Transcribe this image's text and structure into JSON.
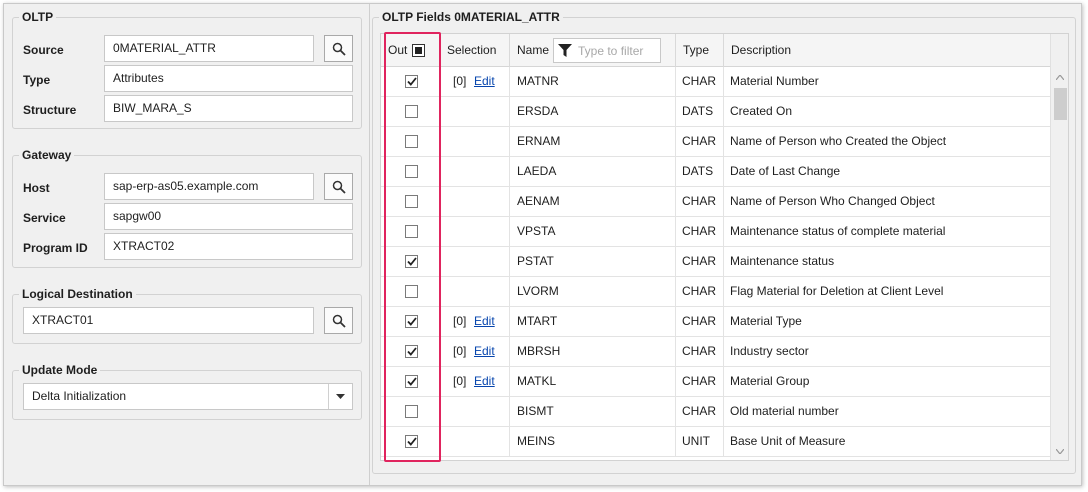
{
  "oltp": {
    "legend": "OLTP",
    "source_label": "Source",
    "source_value": "0MATERIAL_ATTR",
    "type_label": "Type",
    "type_value": "Attributes",
    "structure_label": "Structure",
    "structure_value": "BIW_MARA_S"
  },
  "gateway": {
    "legend": "Gateway",
    "host_label": "Host",
    "host_value": "sap-erp-as05.example.com",
    "service_label": "Service",
    "service_value": "sapgw00",
    "program_label": "Program ID",
    "program_value": "XTRACT02"
  },
  "logical_destination": {
    "legend": "Logical Destination",
    "value": "XTRACT01"
  },
  "update_mode": {
    "legend": "Update Mode",
    "selected": "Delta Initialization"
  },
  "fields": {
    "legend": "OLTP Fields 0MATERIAL_ATTR",
    "columns": {
      "out": "Out",
      "selection": "Selection",
      "name": "Name",
      "filter_placeholder": "Type to filter",
      "type": "Type",
      "description": "Description"
    },
    "rows": [
      {
        "checked": true,
        "count": "[0]",
        "edit": "Edit",
        "name": "MATNR",
        "type": "CHAR",
        "description": "Material Number"
      },
      {
        "checked": false,
        "count": "",
        "edit": "",
        "name": "ERSDA",
        "type": "DATS",
        "description": "Created On"
      },
      {
        "checked": false,
        "count": "",
        "edit": "",
        "name": "ERNAM",
        "type": "CHAR",
        "description": "Name of Person who Created the Object"
      },
      {
        "checked": false,
        "count": "",
        "edit": "",
        "name": "LAEDA",
        "type": "DATS",
        "description": "Date of Last Change"
      },
      {
        "checked": false,
        "count": "",
        "edit": "",
        "name": "AENAM",
        "type": "CHAR",
        "description": "Name of Person Who Changed Object"
      },
      {
        "checked": false,
        "count": "",
        "edit": "",
        "name": "VPSTA",
        "type": "CHAR",
        "description": "Maintenance status of complete material"
      },
      {
        "checked": true,
        "count": "",
        "edit": "",
        "name": "PSTAT",
        "type": "CHAR",
        "description": "Maintenance status"
      },
      {
        "checked": false,
        "count": "",
        "edit": "",
        "name": "LVORM",
        "type": "CHAR",
        "description": "Flag Material for Deletion at Client Level"
      },
      {
        "checked": true,
        "count": "[0]",
        "edit": "Edit",
        "name": "MTART",
        "type": "CHAR",
        "description": "Material Type"
      },
      {
        "checked": true,
        "count": "[0]",
        "edit": "Edit",
        "name": "MBRSH",
        "type": "CHAR",
        "description": "Industry sector"
      },
      {
        "checked": true,
        "count": "[0]",
        "edit": "Edit",
        "name": "MATKL",
        "type": "CHAR",
        "description": "Material Group"
      },
      {
        "checked": false,
        "count": "",
        "edit": "",
        "name": "BISMT",
        "type": "CHAR",
        "description": "Old material number"
      },
      {
        "checked": true,
        "count": "",
        "edit": "",
        "name": "MEINS",
        "type": "UNIT",
        "description": "Base Unit of Measure"
      }
    ]
  },
  "colors": {
    "highlight": "#e0245e",
    "link": "#0645ad",
    "panel_bg": "#f0f0f0"
  }
}
